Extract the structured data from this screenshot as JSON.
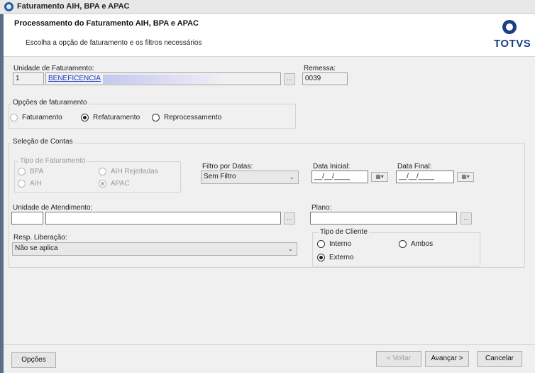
{
  "window": {
    "title": "Faturamento AIH, BPA e APAC"
  },
  "header": {
    "title": "Processamento do Faturamento AIH, BPA e APAC",
    "subtitle": "Escolha a opção de faturamento e os filtros necessários",
    "logo_text": "TOTVS"
  },
  "unidade_faturamento": {
    "label": "Unidade de Faturamento:",
    "code": "1",
    "name": "BENEFICENCIA",
    "lookup_label": "..."
  },
  "remessa": {
    "label": "Remessa:",
    "value": "0039"
  },
  "opcoes_faturamento": {
    "legend": "Opções de faturamento",
    "options": [
      {
        "label": "Faturamento",
        "selected": false,
        "enabled": false
      },
      {
        "label": "Refaturamento",
        "selected": true,
        "enabled": true
      },
      {
        "label": "Reprocessamento",
        "selected": false,
        "enabled": true
      }
    ]
  },
  "selecao_contas": {
    "legend": "Seleção de Contas",
    "tipo_faturamento": {
      "legend": "Tipo de Faturamento",
      "options": [
        {
          "label": "BPA",
          "selected": false
        },
        {
          "label": "AIH Rejeitadas",
          "selected": false
        },
        {
          "label": "AIH",
          "selected": false
        },
        {
          "label": "APAC",
          "selected": true
        }
      ]
    },
    "filtro_datas": {
      "label": "Filtro por Datas:",
      "value": "Sem Filtro"
    },
    "data_inicial": {
      "label": "Data Inicial:",
      "value": "__/__/____"
    },
    "data_final": {
      "label": "Data Final:",
      "value": "__/__/____"
    },
    "unidade_atendimento": {
      "label": "Unidade de Atendimento:",
      "code": "",
      "name": "",
      "lookup_label": "..."
    },
    "plano": {
      "label": "Plano:",
      "value": "",
      "lookup_label": "..."
    },
    "resp_liberacao": {
      "label": "Resp. Liberação:",
      "value": "Não se aplica"
    },
    "tipo_cliente": {
      "legend": "Tipo de Cliente",
      "options": [
        {
          "label": "Interno",
          "selected": false
        },
        {
          "label": "Ambos",
          "selected": false
        },
        {
          "label": "Externo",
          "selected": true
        }
      ]
    }
  },
  "footer": {
    "opcoes": "Opções",
    "voltar": "< Voltar",
    "avancar": "Avançar >",
    "cancelar": "Cancelar"
  },
  "colors": {
    "link": "#1a3cc8",
    "brand": "#1a3f85",
    "selection_blur": "#c7c8ef"
  }
}
